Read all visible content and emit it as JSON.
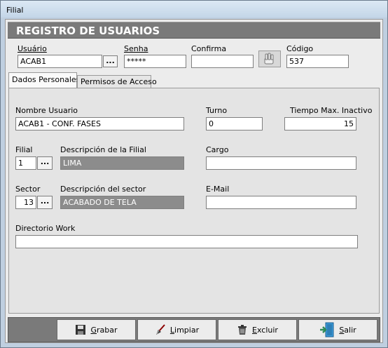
{
  "window": {
    "title": "Filial"
  },
  "header": {
    "title": "REGISTRO DE USUARIOS"
  },
  "top": {
    "usuario_label": "Usuário",
    "usuario_value": "ACAB1",
    "lookup_button": "...",
    "senha_label": "Senha",
    "senha_value": "*****",
    "confirma_label": "Confirma",
    "confirma_value": "",
    "codigo_label": "Código",
    "codigo_value": "537"
  },
  "tabs": [
    {
      "label": "Dados Personales",
      "active": true
    },
    {
      "label": "Permisos de Acceso",
      "active": false
    }
  ],
  "form": {
    "nombre_label": "Nombre Usuario",
    "nombre_value": "ACAB1 - CONF. FASES",
    "turno_label": "Turno",
    "turno_value": "0",
    "tiempo_label": "Tiempo Max. Inactivo",
    "tiempo_value": "15",
    "filial_label": "Filial",
    "filial_value": "1",
    "filial_btn": "...",
    "desc_filial_label": "Descripción de la Filial",
    "desc_filial_value": "LIMA",
    "cargo_label": "Cargo",
    "cargo_value": "",
    "sector_label": "Sector",
    "sector_value": "13",
    "sector_btn": "...",
    "desc_sector_label": "Descripción del sector",
    "desc_sector_value": "ACABADO DE TELA",
    "email_label": "E-Mail",
    "email_value": "",
    "directorio_label": "Directorio Work",
    "directorio_value": ""
  },
  "footer": {
    "grabar_first": "G",
    "grabar_rest": "rabar",
    "limpiar_first": "L",
    "limpiar_rest": "impiar",
    "excluir_first": "E",
    "excluir_rest": "xcluir",
    "salir_first": "S",
    "salir_rest": "alir"
  },
  "icons": {
    "grabar": "floppy-disk-icon",
    "limpiar": "broom-icon",
    "excluir": "trash-icon",
    "salir": "exit-door-icon",
    "confirm": "hand-icon"
  }
}
